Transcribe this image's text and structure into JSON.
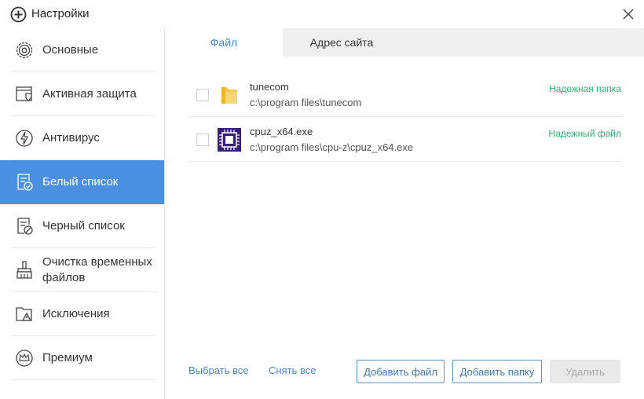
{
  "window": {
    "title": "Настройки"
  },
  "sidebar": {
    "items": [
      {
        "label": "Основные",
        "icon": "gear-icon"
      },
      {
        "label": "Активная защита",
        "icon": "shield-window-icon"
      },
      {
        "label": "Антивирус",
        "icon": "lightning-circle-icon"
      },
      {
        "label": "Белый список",
        "icon": "whitelist-icon",
        "active": true
      },
      {
        "label": "Черный список",
        "icon": "blacklist-icon"
      },
      {
        "label": "Очистка временных файлов",
        "icon": "broom-icon"
      },
      {
        "label": "Исключения",
        "icon": "folder-warning-icon"
      },
      {
        "label": "Премиум",
        "icon": "crown-icon"
      }
    ]
  },
  "tabs": [
    {
      "label": "Файл",
      "active": true
    },
    {
      "label": "Адрес сайта",
      "active": false
    }
  ],
  "entries": [
    {
      "name": "tunecom",
      "path": "c:\\program files\\tunecom",
      "status": "Надежная папка",
      "icon": "folder-icon"
    },
    {
      "name": "cpuz_x64.exe",
      "path": "c:\\program files\\cpu-z\\cpuz_x64.exe",
      "status": "Надежный файл",
      "icon": "cpu-z-icon"
    }
  ],
  "actions": {
    "select_all": "Выбрать все",
    "deselect_all": "Снять все",
    "add_file": "Добавить файл",
    "add_folder": "Добавить папку",
    "delete": "Удалить"
  },
  "colors": {
    "accent": "#4a90e2",
    "link": "#4a86c8",
    "status_green": "#2bb673"
  }
}
